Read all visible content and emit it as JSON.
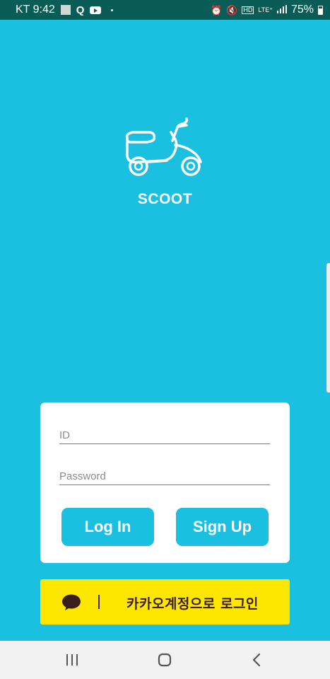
{
  "status_bar": {
    "carrier_time": "KT 9:42",
    "notification_icons": [
      "qr-icon",
      "q-icon",
      "youtube-icon",
      "dot-icon"
    ],
    "system_icons": [
      "alarm-icon",
      "mute-icon",
      "hd-icon",
      "lte-icon",
      "signal-icon"
    ],
    "lte_label": "LTE⁺",
    "battery_percent": "75%",
    "battery_level": 0.75
  },
  "branding": {
    "logo_icon": "scooter-icon",
    "app_name": "SCOOT"
  },
  "login_form": {
    "id_placeholder": "ID",
    "password_placeholder": "Password",
    "login_label": "Log In",
    "signup_label": "Sign Up"
  },
  "kakao_login": {
    "icon": "speech-bubble-icon",
    "label": "카카오계정으로 로그인"
  },
  "navigation_bar": {
    "items": [
      "recent-apps-icon",
      "home-icon",
      "back-icon"
    ]
  },
  "colors": {
    "background": "#1bbfe0",
    "status_bar": "#0a5c56",
    "card": "#ffffff",
    "button": "#1bbfe0",
    "kakao_yellow": "#fde700",
    "kakao_brown": "#3a1d1d",
    "nav_bar": "#f2f2f2"
  }
}
